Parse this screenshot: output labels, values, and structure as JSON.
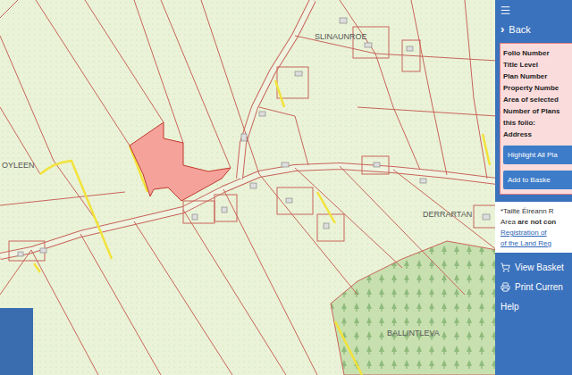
{
  "map": {
    "places": [
      {
        "name": "SLINAUNROE"
      },
      {
        "name": "OYLEEN"
      },
      {
        "name": "DERRARTAN"
      },
      {
        "name": "BALLINTLEVA"
      }
    ]
  },
  "sidebar": {
    "back": {
      "arrow": "›",
      "label": "Back"
    },
    "property_fields": [
      "Folio Number",
      "Title Level",
      "Plan Number",
      "Property Numbe",
      "Area of selected",
      "Number of Plans",
      "this folio:",
      "Address"
    ],
    "buttons": [
      "Highlight All Pla",
      "Add to Baske"
    ],
    "notice": [
      {
        "kind": "text",
        "parts": [
          {
            "text": "*Tailte Éireann R",
            "bold": false
          }
        ]
      },
      {
        "kind": "text",
        "parts": [
          {
            "text": "Area",
            "bold": false
          },
          {
            "text": "are not con",
            "bold": true
          }
        ]
      },
      {
        "kind": "link",
        "parts": [
          {
            "text": "Registration of",
            "bold": false
          }
        ]
      },
      {
        "kind": "link",
        "parts": [
          {
            "text": "of the Land Reg",
            "bold": false
          }
        ]
      }
    ],
    "menu": [
      {
        "label": "View Basket",
        "kind": "basket"
      },
      {
        "label": "Print Curren",
        "kind": "print"
      },
      {
        "label": "Help",
        "kind": "plain"
      }
    ]
  }
}
